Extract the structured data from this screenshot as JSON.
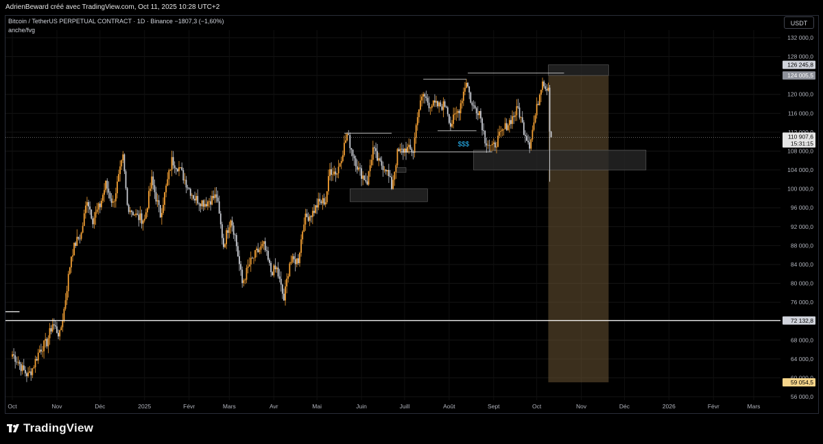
{
  "header": {
    "publish_info": "AdrienBeward créé avec TradingView.com, Oct 11, 2025 10:28 UTC+2"
  },
  "legend": {
    "symbol": "Bitcoin / TetherUS PERPETUAL CONTRACT · 1D · Binance",
    "change": "−1807,3 (−1,60%)",
    "indicator": "anche/fvg"
  },
  "currency_button": "USDT",
  "brand": "TradingView",
  "colors": {
    "up": "#f7a234",
    "down": "#c9ccd3",
    "zone_fill": "#6b5634",
    "box_fill": "#2a2a2a",
    "price_tag_bg": "#d1d4dc",
    "last_tag_bg": "#e6e6e6",
    "target_tag_bg": "#f5d48a",
    "liquidity_text": "#29b6f6"
  },
  "chart_data": {
    "type": "candlestick",
    "timeframe": "1D",
    "ylim": [
      55000,
      134000
    ],
    "y_ticks": [
      "132 000,0",
      "128 000,0",
      "124 000,0",
      "120 000,0",
      "116 000,0",
      "112 000,0",
      "108 000,0",
      "104 000,0",
      "100 000,0",
      "96 000,0",
      "92 000,0",
      "88 000,0",
      "84 000,0",
      "80 000,0",
      "76 000,0",
      "72 000,0",
      "68 000,0",
      "64 000,0",
      "60 000,0",
      "56 000,0"
    ],
    "x_ticks": [
      "Oct",
      "Nov",
      "Déc",
      "2025",
      "Févr",
      "Mars",
      "Avr",
      "Mai",
      "Juin",
      "Juill",
      "Août",
      "Sept",
      "Oct",
      "Nov",
      "Déc",
      "2026",
      "Févr",
      "Mars"
    ],
    "close_path": [
      [
        "2024-10-01",
        65000
      ],
      [
        "2024-10-05",
        63500
      ],
      [
        "2024-10-08",
        61800
      ],
      [
        "2024-10-12",
        60500
      ],
      [
        "2024-10-15",
        62000
      ],
      [
        "2024-10-20",
        66000
      ],
      [
        "2024-10-25",
        67500
      ],
      [
        "2024-10-29",
        71500
      ],
      [
        "2024-11-03",
        69000
      ],
      [
        "2024-11-06",
        74500
      ],
      [
        "2024-11-11",
        86000
      ],
      [
        "2024-11-14",
        88500
      ],
      [
        "2024-11-18",
        90500
      ],
      [
        "2024-11-22",
        98000
      ],
      [
        "2024-11-26",
        93500
      ],
      [
        "2024-12-01",
        96500
      ],
      [
        "2024-12-05",
        101000
      ],
      [
        "2024-12-10",
        96800
      ],
      [
        "2024-12-17",
        106500
      ],
      [
        "2024-12-20",
        96500
      ],
      [
        "2024-12-27",
        94000
      ],
      [
        "2025-01-01",
        93500
      ],
      [
        "2025-01-06",
        101800
      ],
      [
        "2025-01-12",
        94500
      ],
      [
        "2025-01-20",
        106000
      ],
      [
        "2025-01-25",
        104500
      ],
      [
        "2025-02-01",
        100000
      ],
      [
        "2025-02-05",
        98000
      ],
      [
        "2025-02-12",
        97000
      ],
      [
        "2025-02-20",
        98500
      ],
      [
        "2025-02-25",
        88000
      ],
      [
        "2025-03-02",
        94000
      ],
      [
        "2025-03-05",
        90000
      ],
      [
        "2025-03-10",
        80000
      ],
      [
        "2025-03-15",
        84000
      ],
      [
        "2025-03-20",
        86500
      ],
      [
        "2025-03-25",
        88000
      ],
      [
        "2025-03-30",
        82500
      ],
      [
        "2025-04-03",
        83000
      ],
      [
        "2025-04-08",
        76500
      ],
      [
        "2025-04-12",
        84500
      ],
      [
        "2025-04-18",
        85000
      ],
      [
        "2025-04-22",
        93500
      ],
      [
        "2025-04-28",
        95000
      ],
      [
        "2025-05-02",
        97000
      ],
      [
        "2025-05-07",
        97500
      ],
      [
        "2025-05-10",
        104000
      ],
      [
        "2025-05-15",
        103500
      ],
      [
        "2025-05-22",
        111500
      ],
      [
        "2025-05-25",
        108500
      ],
      [
        "2025-05-30",
        104000
      ],
      [
        "2025-06-05",
        101500
      ],
      [
        "2025-06-09",
        108500
      ],
      [
        "2025-06-13",
        105500
      ],
      [
        "2025-06-18",
        104500
      ],
      [
        "2025-06-22",
        100500
      ],
      [
        "2025-06-26",
        107500
      ],
      [
        "2025-07-02",
        108500
      ],
      [
        "2025-07-07",
        108000
      ],
      [
        "2025-07-10",
        116000
      ],
      [
        "2025-07-14",
        120000
      ],
      [
        "2025-07-18",
        118000
      ],
      [
        "2025-07-25",
        117500
      ],
      [
        "2025-07-30",
        117800
      ],
      [
        "2025-08-02",
        113500
      ],
      [
        "2025-08-08",
        117000
      ],
      [
        "2025-08-13",
        123000
      ],
      [
        "2025-08-17",
        117500
      ],
      [
        "2025-08-22",
        116500
      ],
      [
        "2025-08-26",
        110500
      ],
      [
        "2025-08-31",
        108500
      ],
      [
        "2025-09-05",
        111000
      ],
      [
        "2025-09-10",
        113500
      ],
      [
        "2025-09-15",
        115500
      ],
      [
        "2025-09-18",
        117000
      ],
      [
        "2025-09-22",
        112500
      ],
      [
        "2025-09-26",
        109500
      ],
      [
        "2025-10-01",
        117000
      ],
      [
        "2025-10-05",
        123500
      ],
      [
        "2025-10-07",
        121500
      ],
      [
        "2025-10-09",
        121800
      ],
      [
        "2025-10-10",
        113000
      ],
      [
        "2025-10-11",
        110907.6
      ]
    ],
    "last_price": 110907.6,
    "last_price_label": "110 907,6",
    "countdown": "15:31:15",
    "price_labels": [
      {
        "value": 126245.8,
        "label": "126 245,8"
      },
      {
        "value": 124005.5,
        "label": "124 005,5"
      },
      {
        "value": 72132.8,
        "label": "72 132,8"
      },
      {
        "value": 59054.5,
        "label": "59 054,5"
      }
    ],
    "annotations": {
      "liquidity_label": "$$$",
      "swing_high_lines": [
        {
          "from": "2025-05-20",
          "to": "2025-06-22",
          "value": 111800
        },
        {
          "from": "2025-07-14",
          "to": "2025-08-13",
          "value": 123200
        },
        {
          "from": "2025-08-14",
          "to": "2025-10-20",
          "value": 124500
        }
      ],
      "range_lines": [
        {
          "from": "2025-07-24",
          "to": "2025-08-20",
          "value": 112300
        },
        {
          "from": "2025-06-28",
          "to": "2025-08-31",
          "value": 107800
        }
      ],
      "horizontal_level": {
        "value": 72132.8,
        "from": "2024-09-25",
        "to": "2025-11-20"
      },
      "left_marker_level": {
        "value": 74000,
        "from": "2024-09-25",
        "to": "2024-10-06"
      },
      "boxes": [
        {
          "from": "2025-05-24",
          "to": "2025-07-17",
          "top": 100000,
          "bottom": 97300
        },
        {
          "from": "2025-06-25",
          "to": "2025-07-02",
          "top": 104500,
          "bottom": 103500
        },
        {
          "from": "2025-08-18",
          "to": "2025-12-16",
          "top": 108200,
          "bottom": 104000
        },
        {
          "from": "2025-10-09",
          "to": "2025-11-20",
          "top": 126245.8,
          "bottom": 124005.5
        }
      ],
      "target_zone": {
        "from": "2025-10-09",
        "to": "2025-11-20",
        "top": 124005.5,
        "bottom": 59054.5
      }
    }
  }
}
